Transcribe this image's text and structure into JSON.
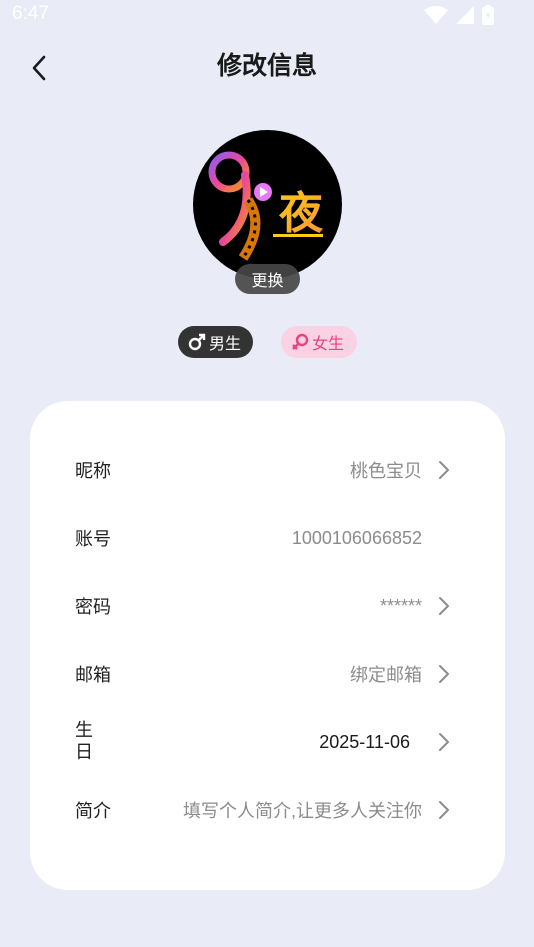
{
  "status_bar": {
    "time": "6:47"
  },
  "header": {
    "title": "修改信息"
  },
  "avatar": {
    "change_label": "更换",
    "logo_text": "夜"
  },
  "gender": {
    "male_label": "男生",
    "female_label": "女生",
    "selected": "male"
  },
  "profile": {
    "nickname": {
      "label": "昵称",
      "value": "桃色宝贝"
    },
    "account": {
      "label": "账号",
      "value": "1000106066852"
    },
    "password": {
      "label": "密码",
      "value": "******"
    },
    "email": {
      "label": "邮箱",
      "value": "绑定邮箱"
    },
    "birthday": {
      "label_line1": "生",
      "label_line2": "日",
      "value": "2025-11-06"
    },
    "bio": {
      "label": "简介",
      "value": "填写个人简介,让更多人关注你"
    }
  },
  "colors": {
    "background": "#e9ecf6",
    "female_accent": "#e8437f",
    "male_chip": "#333333"
  }
}
